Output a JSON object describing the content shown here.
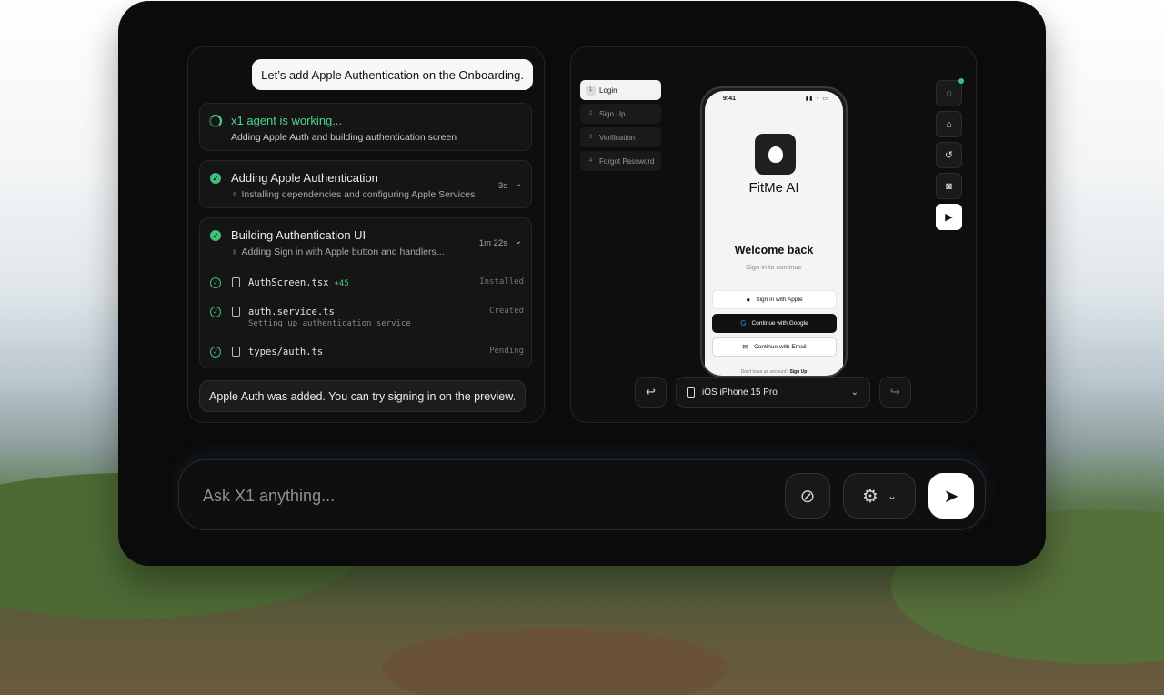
{
  "colors": {
    "accent_green": "#3fbf7a",
    "frame_bg": "#0b0b0b",
    "panel_bg": "#0e0e0e"
  },
  "chat": {
    "user_message": "Let’s add Apple Authentication on the Onboarding.",
    "working": {
      "title": "x1 agent is working...",
      "subtitle": "Adding Apple Auth and building authentication screen",
      "icon": "spinner-icon"
    },
    "tasks": [
      {
        "title": "Adding Apple Authentication",
        "subtitle": "Installing dependencies and configuring Apple Services",
        "time": "3s",
        "icon": "check-circle-icon"
      },
      {
        "title": "Building Authentication UI",
        "subtitle": "Adding Sign in with Apple button and handlers...",
        "time": "1m 22s",
        "icon": "check-circle-icon"
      }
    ],
    "files": [
      {
        "name": "AuthScreen.tsx",
        "additions": "+45",
        "status": "Installed",
        "desc": ""
      },
      {
        "name": "auth.service.ts",
        "additions": "",
        "status": "Created",
        "desc": "Setting up authentication service"
      },
      {
        "name": "types/auth.ts",
        "additions": "",
        "status": "Pending",
        "desc": ""
      }
    ],
    "agent_message": "Apple Auth was added. You can try signing in on the preview."
  },
  "preview": {
    "screens": [
      {
        "num": "1",
        "label": "Login",
        "active": true
      },
      {
        "num": "2",
        "label": "Sign Up",
        "active": false
      },
      {
        "num": "3",
        "label": "Verification",
        "active": false
      },
      {
        "num": "4",
        "label": "Forgot Password",
        "active": false
      }
    ],
    "phone": {
      "time": "9:41",
      "app_name": "FitMe AI",
      "welcome": "Welcome back",
      "welcome_sub": "Sign in to continue",
      "btn_apple": "Sign in with Apple",
      "btn_google": "Continue with Google",
      "btn_email": "Continue with Email",
      "signup_prompt": "Don't have an account?",
      "signup_link": "Sign Up"
    },
    "tools": [
      "refresh-spinner-icon",
      "home-icon",
      "rotate-icon",
      "camera-icon",
      "play-icon"
    ],
    "device": "iOS iPhone 15 Pro"
  },
  "composer": {
    "placeholder": "Ask X1 anything..."
  }
}
